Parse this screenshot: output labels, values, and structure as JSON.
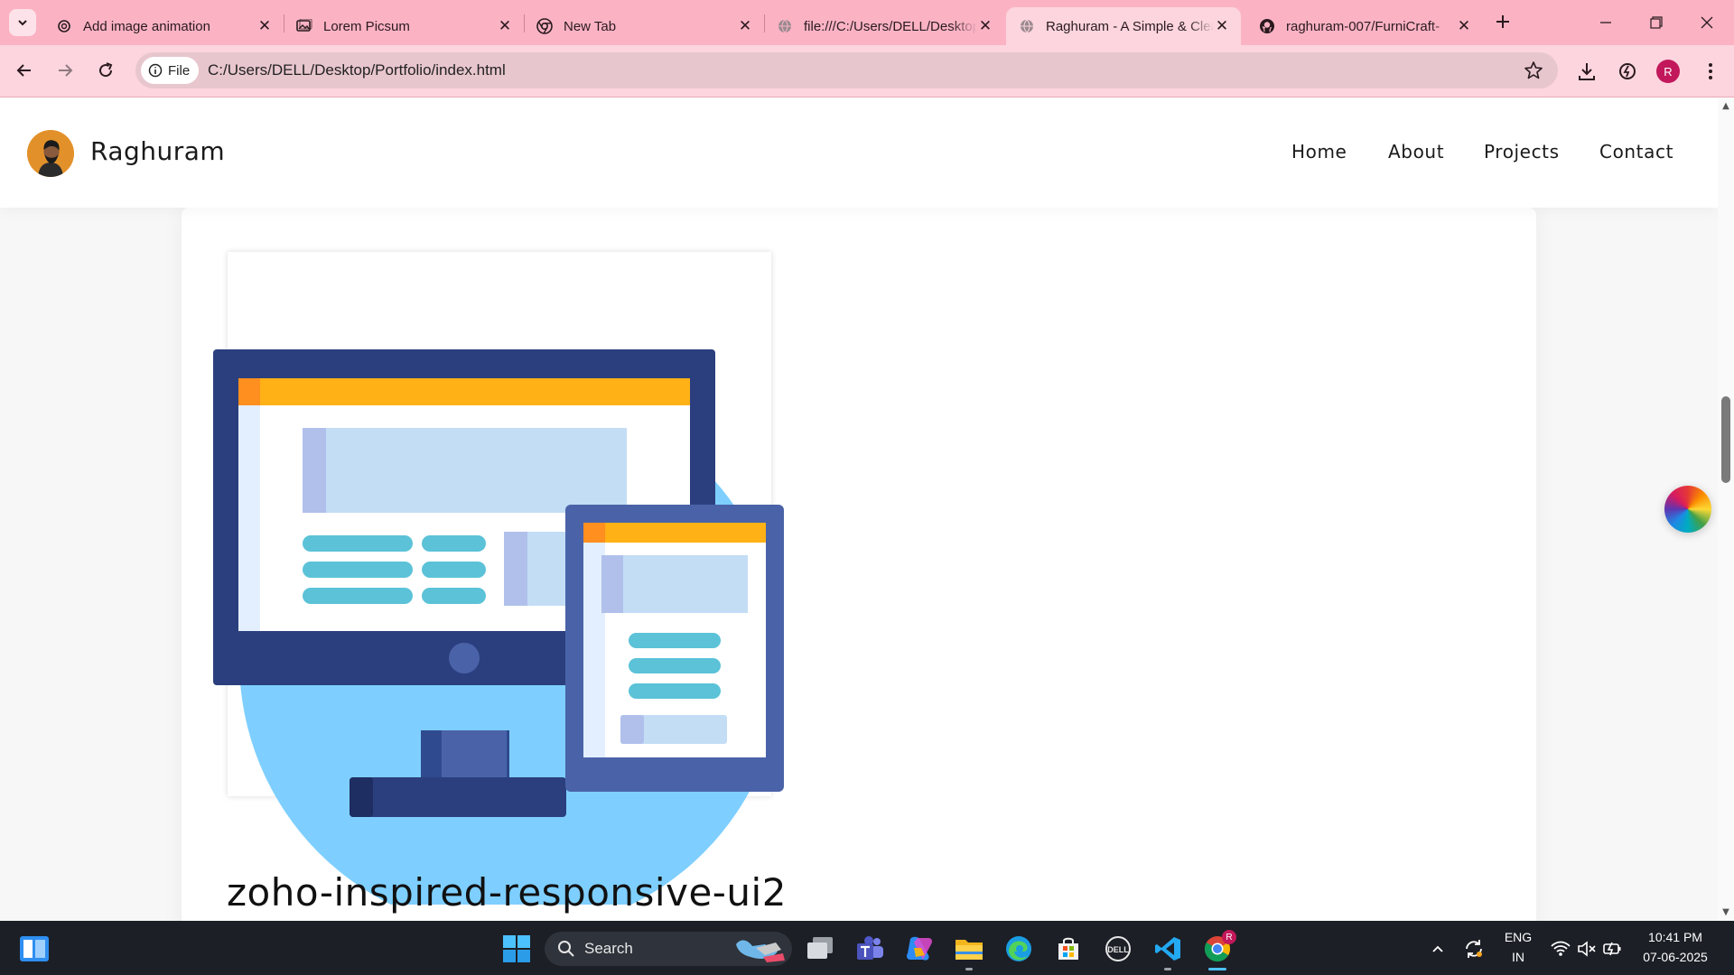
{
  "browser": {
    "tabs": [
      {
        "title": "Add image animation",
        "active": false
      },
      {
        "title": "Lorem Picsum",
        "active": false
      },
      {
        "title": "New Tab",
        "active": false
      },
      {
        "title": "file:///C:/Users/DELL/Desktop/",
        "active": false
      },
      {
        "title": "Raghuram - A Simple & Clean",
        "active": true
      },
      {
        "title": "raghuram-007/FurniCraft-",
        "active": false
      }
    ],
    "address": {
      "chip_label": "File",
      "url": "C:/Users/DELL/Desktop/Portfolio/index.html"
    },
    "profile_initial": "R"
  },
  "site": {
    "brand": "Raghuram",
    "nav": [
      "Home",
      "About",
      "Projects",
      "Contact"
    ],
    "project_title": "zoho-inspired-responsive-ui2"
  },
  "taskbar": {
    "search_label": "Search",
    "lang_line1": "ENG",
    "lang_line2": "IN",
    "time": "10:41 PM",
    "date": "07-06-2025",
    "chrome_badge": "R"
  },
  "colors": {
    "tabstrip": "#fbb3c4",
    "toolbar": "#fcd5de",
    "illus_circle": "#7ecfff",
    "monitor": "#2b3f7e",
    "orange_bar": "#ffb116",
    "taskbar": "#1c1f26"
  }
}
